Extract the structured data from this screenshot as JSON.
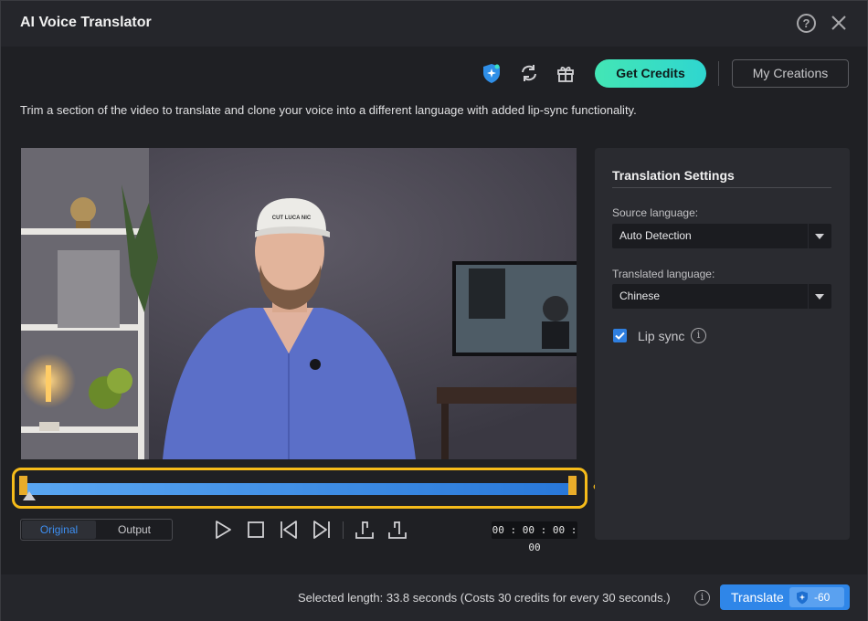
{
  "window": {
    "title": "AI Voice Translator",
    "help_glyph": "?",
    "icons": [
      "help-icon",
      "close-icon"
    ]
  },
  "toolbar": {
    "icons": [
      "ai-shield-icon",
      "refresh-icon",
      "gift-icon"
    ],
    "get_credits": "Get Credits",
    "my_creations": "My Creations"
  },
  "description": "Trim a section of the video to translate and clone your voice into a different language with added lip-sync functionality.",
  "player": {
    "toggle": {
      "original": "Original",
      "output": "Output",
      "selected": "Original"
    },
    "controls": [
      "play-icon",
      "stop-icon",
      "previous-frame-icon",
      "next-frame-icon",
      "set-in-point-icon",
      "set-out-point-icon"
    ],
    "timecode": "00 : 00 : 00 : 00",
    "cap_text": "CUT LUCA NIC"
  },
  "settings": {
    "title": "Translation Settings",
    "source_label": "Source language:",
    "source_value": "Auto Detection",
    "target_label": "Translated language:",
    "target_value": "Chinese",
    "lip_sync_label": "Lip sync",
    "lip_sync_checked": true,
    "info_glyph": "i"
  },
  "footer": {
    "selected_length": "Selected length: 33.8 seconds (Costs 30 credits for every 30 seconds.)",
    "translate_label": "Translate",
    "credit_cost": "-60"
  },
  "colors": {
    "accent": "#2f86e8",
    "credits_gradient_start": "#43e6b5",
    "highlight_frame": "#f5bb1a",
    "trim_handle": "#e8ac2a"
  }
}
